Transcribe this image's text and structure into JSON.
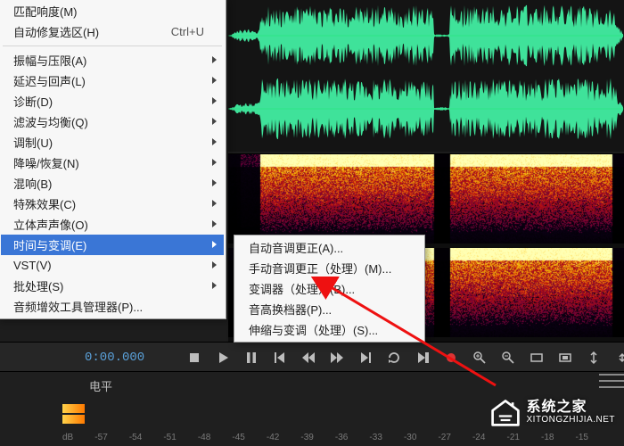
{
  "mainMenu": [
    {
      "label": "匹配响度(M)",
      "shortcut": ""
    },
    {
      "label": "自动修复选区(H)",
      "shortcut": "Ctrl+U"
    },
    {
      "sep": true
    },
    {
      "label": "振幅与压限(A)",
      "sub": true
    },
    {
      "label": "延迟与回声(L)",
      "sub": true
    },
    {
      "label": "诊断(D)",
      "sub": true
    },
    {
      "label": "滤波与均衡(Q)",
      "sub": true
    },
    {
      "label": "调制(U)",
      "sub": true
    },
    {
      "label": "降噪/恢复(N)",
      "sub": true
    },
    {
      "label": "混响(B)",
      "sub": true
    },
    {
      "label": "特殊效果(C)",
      "sub": true
    },
    {
      "label": "立体声声像(O)",
      "sub": true
    },
    {
      "label": "时间与变调(E)",
      "sub": true,
      "highlight": true
    },
    {
      "label": "VST(V)",
      "sub": true
    },
    {
      "label": "批处理(S)",
      "sub": true
    },
    {
      "label": "音频增效工具管理器(P)..."
    }
  ],
  "subMenu": [
    {
      "label": "自动音调更正(A)..."
    },
    {
      "label": "手动音调更正（处理）(M)..."
    },
    {
      "label": "变调器（处理）(B)..."
    },
    {
      "label": "音高换档器(P)..."
    },
    {
      "label": "伸缩与变调（处理）(S)..."
    }
  ],
  "transport": {
    "time": "0:00.000",
    "buttons": [
      "stop",
      "play",
      "pause",
      "prev",
      "rew",
      "fwd",
      "next",
      "loop",
      "skip",
      "record"
    ],
    "rightButtons": [
      "zoom-in",
      "zoom-out",
      "zoom-full",
      "zoom-sel",
      "zoom-in-v",
      "zoom-out-v"
    ]
  },
  "levels": {
    "title": "电平",
    "scale": [
      "dB",
      "-57",
      "-54",
      "-51",
      "-48",
      "-45",
      "-42",
      "-39",
      "-36",
      "-33",
      "-30",
      "-27",
      "-24",
      "-21",
      "-18",
      "-15"
    ]
  },
  "watermark": {
    "zh": "系统之家",
    "url": "XITONGZHIJIA.NET"
  }
}
